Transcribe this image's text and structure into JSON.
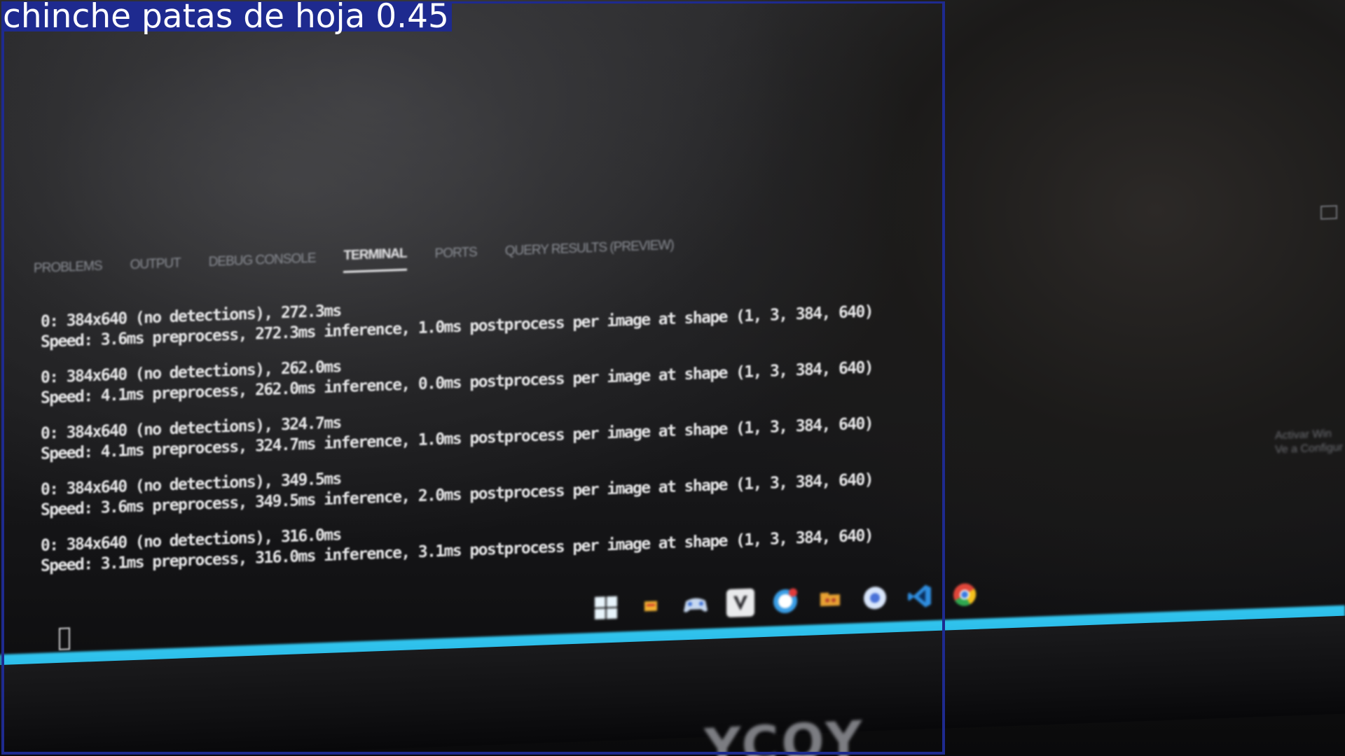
{
  "detection": {
    "label": "chinche patas de hoja 0.45",
    "box_color": "#1e2a8f"
  },
  "panel": {
    "tabs": [
      {
        "label": "PROBLEMS",
        "active": false
      },
      {
        "label": "OUTPUT",
        "active": false
      },
      {
        "label": "DEBUG CONSOLE",
        "active": false
      },
      {
        "label": "TERMINAL",
        "active": true
      },
      {
        "label": "PORTS",
        "active": false
      },
      {
        "label": "QUERY RESULTS (PREVIEW)",
        "active": false
      }
    ]
  },
  "terminal": {
    "entries": [
      {
        "line1": "0: 384x640 (no detections), 272.3ms",
        "line2": "Speed: 3.6ms preprocess, 272.3ms inference, 1.0ms postprocess per image at shape (1, 3, 384, 640)"
      },
      {
        "line1": "0: 384x640 (no detections), 262.0ms",
        "line2": "Speed: 4.1ms preprocess, 262.0ms inference, 0.0ms postprocess per image at shape (1, 3, 384, 640)"
      },
      {
        "line1": "0: 384x640 (no detections), 324.7ms",
        "line2": "Speed: 4.1ms preprocess, 324.7ms inference, 1.0ms postprocess per image at shape (1, 3, 384, 640)"
      },
      {
        "line1": "0: 384x640 (no detections), 349.5ms",
        "line2": "Speed: 3.6ms preprocess, 349.5ms inference, 2.0ms postprocess per image at shape (1, 3, 384, 640)"
      },
      {
        "line1": "0: 384x640 (no detections), 316.0ms",
        "line2": "Speed: 3.1ms preprocess, 316.0ms inference, 3.1ms postprocess per image at shape (1, 3, 384, 640)"
      }
    ]
  },
  "taskbar": {
    "color": "#2bbde9",
    "icons": [
      "windows-start-icon",
      "file-explorer-icon",
      "game-controller-icon",
      "v-app-icon",
      "chat-app-icon",
      "folder-icon",
      "circle-app-icon",
      "vscode-icon",
      "chrome-icon"
    ]
  },
  "tray": {
    "line1": "Activar Win",
    "line2": "Ve a Configur"
  },
  "bezel": {
    "brand": "YCOY"
  }
}
